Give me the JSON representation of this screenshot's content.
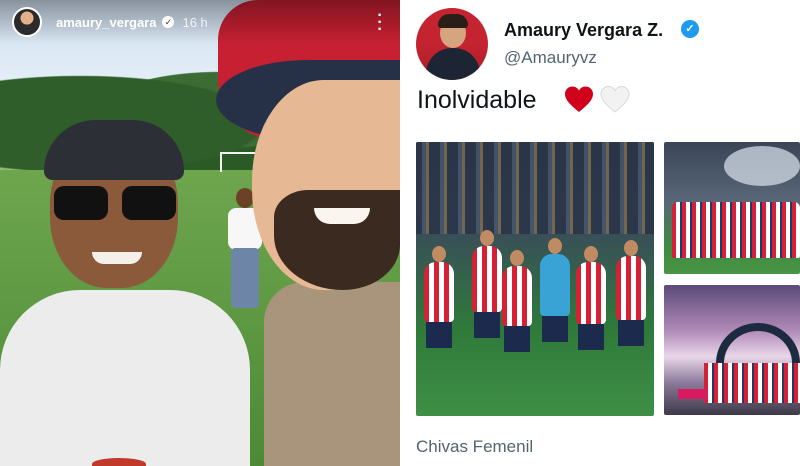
{
  "story": {
    "username": "amaury_vergara",
    "time_ago": "16 h",
    "more_icon": "more-vertical-icon",
    "verified_icon": "verified-badge-icon"
  },
  "tweet": {
    "display_name": "Amaury Vergara Z.",
    "handle": "@Amauryvz",
    "text": "Inolvidable",
    "emojis": [
      "red-heart-icon",
      "white-heart-icon"
    ],
    "caption": "Chivas Femenil",
    "verified_color": "#1d9bf0",
    "heart_red_color": "#d0021b"
  }
}
